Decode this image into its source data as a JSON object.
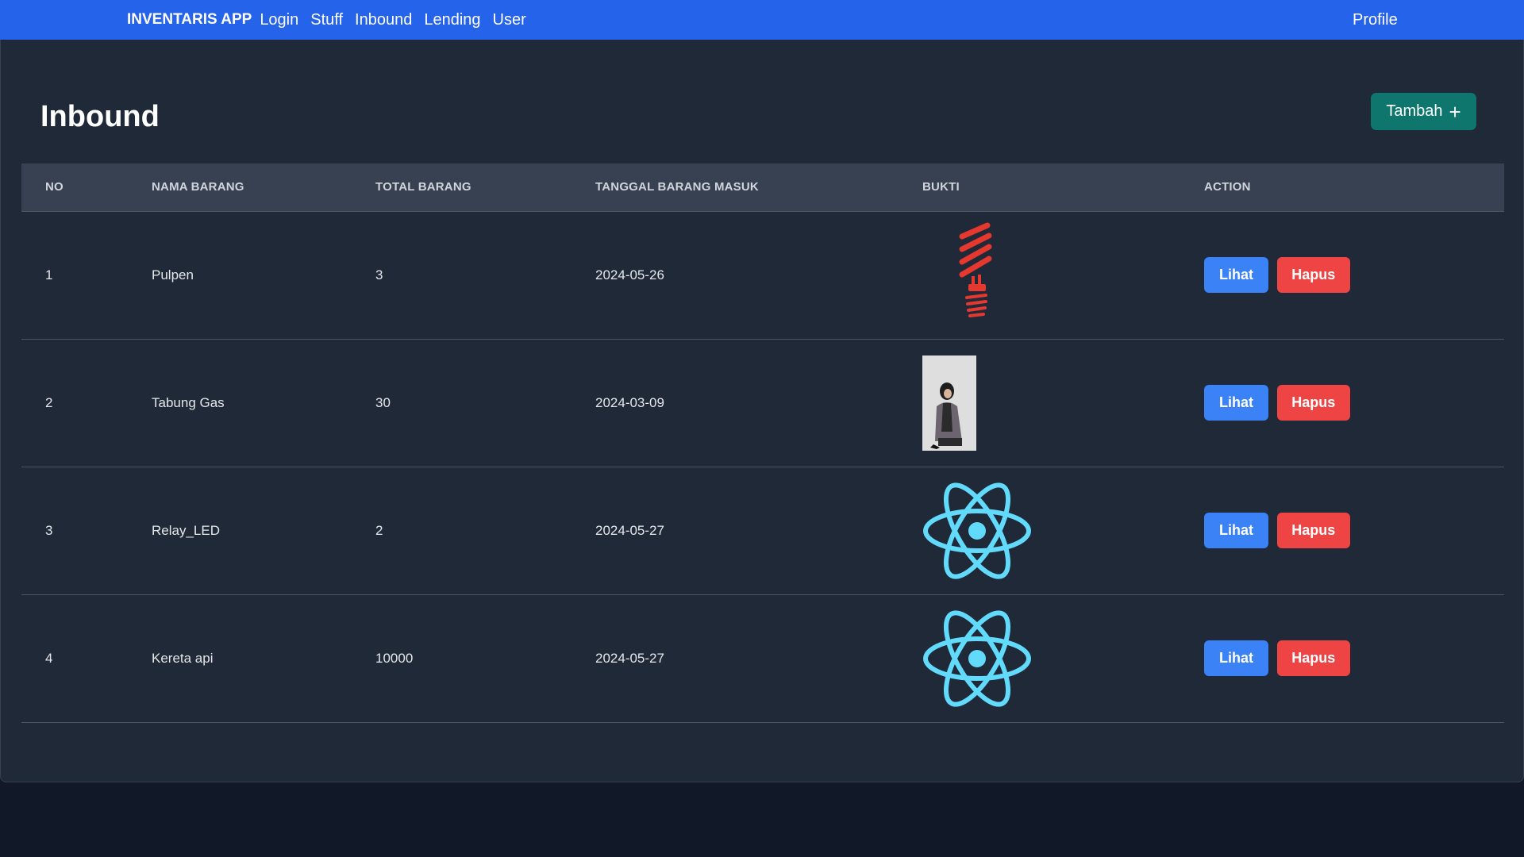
{
  "nav": {
    "brand": "INVENTARIS APP",
    "links": [
      "Login",
      "Stuff",
      "Inbound",
      "Lending",
      "User"
    ],
    "profile": "Profile"
  },
  "page": {
    "title": "Inbound",
    "add_label": "Tambah",
    "add_icon": "plus-icon"
  },
  "table": {
    "headers": [
      "NO",
      "NAMA BARANG",
      "TOTAL BARANG",
      "TANGGAL BARANG MASUK",
      "BUKTI",
      "ACTION"
    ],
    "rows": [
      {
        "no": "1",
        "name": "Pulpen",
        "total": "3",
        "date": "2024-05-26",
        "proof": "lightbulb-image"
      },
      {
        "no": "2",
        "name": "Tabung Gas",
        "total": "30",
        "date": "2024-03-09",
        "proof": "person-photo"
      },
      {
        "no": "3",
        "name": "Relay_LED",
        "total": "2",
        "date": "2024-05-27",
        "proof": "react-logo"
      },
      {
        "no": "4",
        "name": "Kereta api",
        "total": "10000",
        "date": "2024-05-27",
        "proof": "react-logo"
      }
    ],
    "view_label": "Lihat",
    "delete_label": "Hapus"
  },
  "colors": {
    "navbar": "#2563eb",
    "background": "#111827",
    "card": "#1f2937",
    "add_button": "#0f766e",
    "view_button": "#3b82f6",
    "delete_button": "#ef4444",
    "react_logo": "#61dafb",
    "bulb": "#e5382f"
  }
}
